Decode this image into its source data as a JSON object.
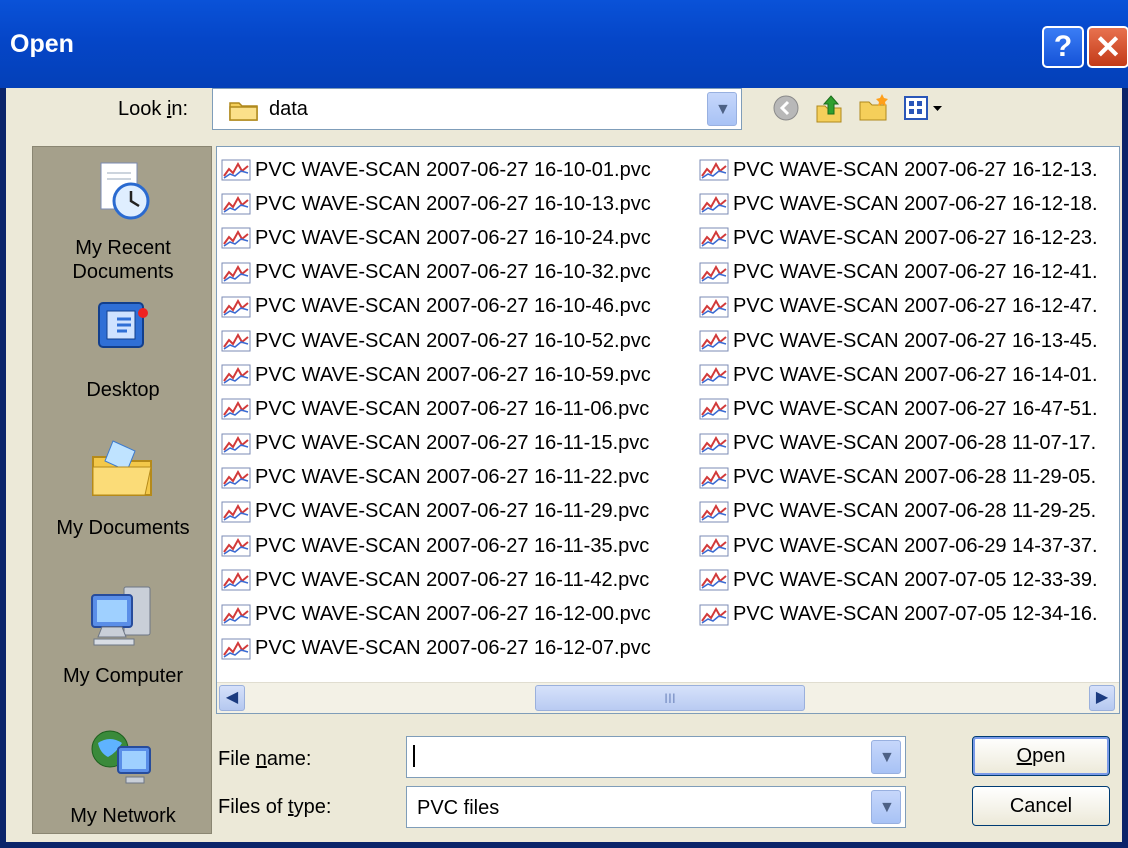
{
  "window": {
    "title": "Open"
  },
  "titlebar": {
    "help_glyph": "?",
    "close_glyph": "✕"
  },
  "toolbar": {
    "look_in_label_pre": "Look ",
    "look_in_label_key": "i",
    "look_in_label_post": "n:",
    "look_in_value": "data",
    "icons": [
      "back-arrow-icon",
      "up-folder-icon",
      "new-folder-icon",
      "view-menu-icon"
    ]
  },
  "sidebar": {
    "items": [
      {
        "label_1": "My Recent",
        "label_2": "Documents",
        "icon": "recent-documents-icon"
      },
      {
        "label_1": "Desktop",
        "icon": "desktop-icon"
      },
      {
        "label_1": "My Documents",
        "icon": "my-documents-icon"
      },
      {
        "label_1": "My Computer",
        "icon": "my-computer-icon"
      },
      {
        "label_1": "My Network",
        "icon": "my-network-icon"
      }
    ]
  },
  "files": {
    "column_1": [
      "PVC WAVE-SCAN 2007-06-27 16-10-01.pvc",
      "PVC WAVE-SCAN 2007-06-27 16-10-13.pvc",
      "PVC WAVE-SCAN 2007-06-27 16-10-24.pvc",
      "PVC WAVE-SCAN 2007-06-27 16-10-32.pvc",
      "PVC WAVE-SCAN 2007-06-27 16-10-46.pvc",
      "PVC WAVE-SCAN 2007-06-27 16-10-52.pvc",
      "PVC WAVE-SCAN 2007-06-27 16-10-59.pvc",
      "PVC WAVE-SCAN 2007-06-27 16-11-06.pvc",
      "PVC WAVE-SCAN 2007-06-27 16-11-15.pvc",
      "PVC WAVE-SCAN 2007-06-27 16-11-22.pvc",
      "PVC WAVE-SCAN 2007-06-27 16-11-29.pvc",
      "PVC WAVE-SCAN 2007-06-27 16-11-35.pvc",
      "PVC WAVE-SCAN 2007-06-27 16-11-42.pvc",
      "PVC WAVE-SCAN 2007-06-27 16-12-00.pvc",
      "PVC WAVE-SCAN 2007-06-27 16-12-07.pvc"
    ],
    "column_2": [
      "PVC WAVE-SCAN 2007-06-27 16-12-13.",
      "PVC WAVE-SCAN 2007-06-27 16-12-18.",
      "PVC WAVE-SCAN 2007-06-27 16-12-23.",
      "PVC WAVE-SCAN 2007-06-27 16-12-41.",
      "PVC WAVE-SCAN 2007-06-27 16-12-47.",
      "PVC WAVE-SCAN 2007-06-27 16-13-45.",
      "PVC WAVE-SCAN 2007-06-27 16-14-01.",
      "PVC WAVE-SCAN 2007-06-27 16-47-51.",
      "PVC WAVE-SCAN 2007-06-28 11-07-17.",
      "PVC WAVE-SCAN 2007-06-28 11-29-05.",
      "PVC WAVE-SCAN 2007-06-28 11-29-25.",
      "PVC WAVE-SCAN 2007-06-29 14-37-37.",
      "PVC WAVE-SCAN 2007-07-05 12-33-39.",
      "PVC WAVE-SCAN 2007-07-05 12-34-16."
    ],
    "file_icon": "wave-file-icon"
  },
  "scrollbar": {
    "left_glyph": "◀",
    "right_glyph": "▶",
    "thumb_grip": "III"
  },
  "form": {
    "file_name_pre": "File ",
    "file_name_key": "n",
    "file_name_post": "ame:",
    "file_name_value": "",
    "files_of_type_pre": "Files of ",
    "files_of_type_key": "t",
    "files_of_type_post": "ype:",
    "files_of_type_value": "PVC files"
  },
  "buttons": {
    "open_key": "O",
    "open_rest": "pen",
    "cancel": "Cancel"
  },
  "colors": {
    "titlebar": "#0546c8",
    "client": "#ece9d8",
    "sidebar": "#a5a08b",
    "accent_border": "#7f9db9"
  }
}
